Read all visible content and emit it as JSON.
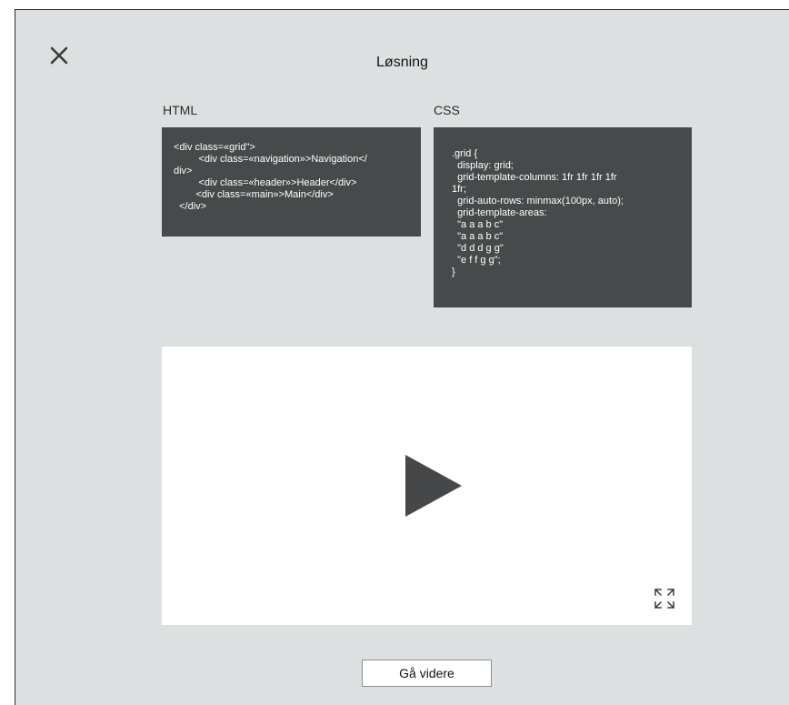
{
  "dialog": {
    "title": "Løsning",
    "close_icon": "close-icon"
  },
  "html_panel": {
    "label": "HTML",
    "code": "<div class=«grid\">\n         <div class=«navigation»>Navigation</\ndiv>\n         <div class=«header»>Header</div>\n        <div class=«main»>Main</div>\n  </div>"
  },
  "css_panel": {
    "label": "CSS",
    "code": ".grid {\n  display: grid;\n  grid-template-columns: 1fr 1fr 1fr 1fr\n1fr;\n  grid-auto-rows: minmax(100px, auto);\n  grid-template-areas:\n  \"a a a b c\"\n  \"a a a b c\"\n  \"d d d g g\"\n  \"e f f g g\";\n}"
  },
  "video": {
    "play_icon": "play-icon",
    "fullscreen_icon": "expand-icon"
  },
  "footer": {
    "next_label": "Gå videre"
  },
  "colors": {
    "background": "#dde0e1",
    "code_panel": "#474a4b",
    "video_area": "#ffffff",
    "play_triangle": "#454748"
  }
}
